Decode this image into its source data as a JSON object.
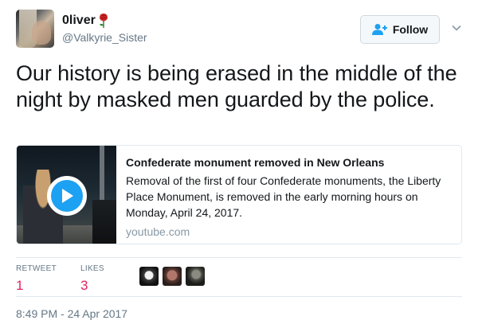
{
  "user": {
    "display_name": "0liver",
    "handle": "@Valkyrie_Sister",
    "emoji_icon": "rose-icon"
  },
  "follow_button": {
    "label": "Follow",
    "icon": "add-person-icon"
  },
  "tweet": {
    "text": "Our history is being erased in the middle of the night by masked men guarded by the police."
  },
  "card": {
    "title": "Confederate monument removed in New Orleans",
    "description": "Removal of the first of four Confederate monuments, the Liberty Place Monument, is removed in the early morning hours on Monday, April 24, 2017.",
    "domain": "youtube.com",
    "thumbnail_icon": "play-icon"
  },
  "stats": {
    "retweet_label": "RETWEET",
    "retweet_count": "1",
    "likes_label": "LIKES",
    "likes_count": "3"
  },
  "timestamp": "8:49 PM - 24 Apr 2017",
  "colors": {
    "accent": "#1da1f2",
    "count": "#e0245e",
    "muted": "#657786",
    "border": "#e1e8ed"
  }
}
